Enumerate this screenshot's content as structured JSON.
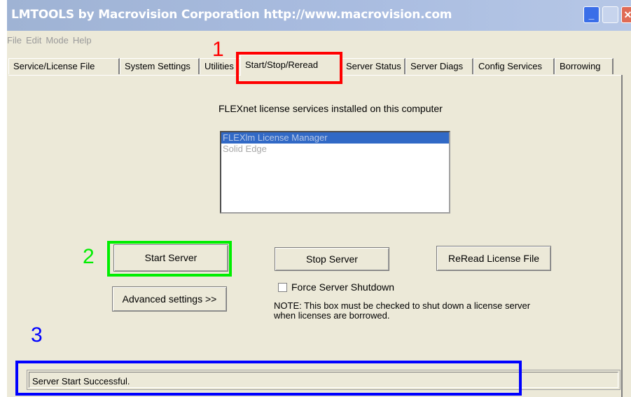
{
  "window": {
    "title": "LMTOOLS by Macrovision Corporation http://www.macrovision.com",
    "controls": {
      "minimize_icon": "minimize-icon",
      "maximize_icon": "maximize-icon",
      "close_icon": "close-icon"
    }
  },
  "menu": [
    "File",
    "Edit",
    "Mode",
    "Help"
  ],
  "tabs": [
    "Service/License File",
    "System Settings",
    "Utilities",
    "Start/Stop/Reread",
    "Server Status",
    "Server Diags",
    "Config Services",
    "Borrowing"
  ],
  "active_tab": "Start/Stop/Reread",
  "services_label": "FLEXnet license services installed on this computer",
  "services": [
    {
      "name": "FLEXlm License Manager",
      "selected": true
    },
    {
      "name": "Solid Edge",
      "selected": false
    }
  ],
  "buttons": {
    "start": "Start Server",
    "stop": "Stop Server",
    "reread": "ReRead License File",
    "advanced": "Advanced settings >>"
  },
  "force_shutdown": {
    "label": "Force Server Shutdown",
    "checked": false
  },
  "note": {
    "line1": "NOTE:  This box must be checked to shut down a license server",
    "line2": "when licenses are borrowed."
  },
  "status": "Server Start Successful.",
  "annotations": [
    {
      "number": "1",
      "color": "#ff0000"
    },
    {
      "number": "2",
      "color": "#00ee00"
    },
    {
      "number": "3",
      "color": "#0000ff"
    }
  ]
}
